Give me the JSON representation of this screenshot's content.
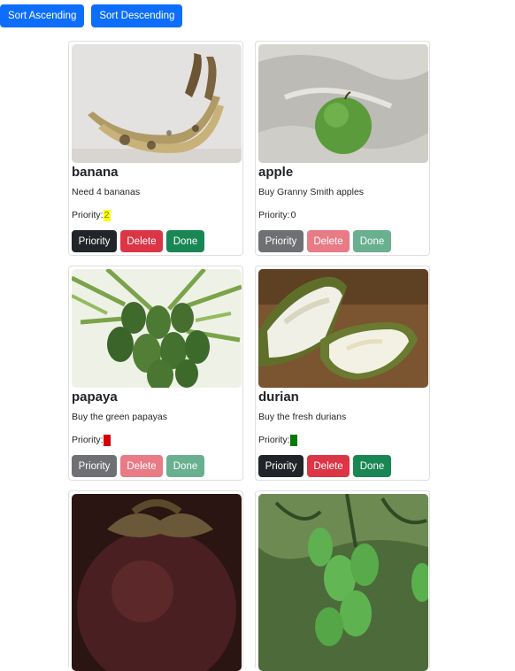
{
  "toolbar": {
    "sort_asc": "Sort Ascending",
    "sort_desc": "Sort Descending"
  },
  "priority_prefix": "Priority: ",
  "buttons": {
    "priority": "Priority",
    "delete": "Delete",
    "done": "Done"
  },
  "colors": {
    "primary": "#0d6efd",
    "dark": "#212529",
    "danger": "#dc3545",
    "success": "#198754",
    "yellow": "#ffff00",
    "red": "#d40000",
    "green": "#007a00"
  },
  "cards": [
    {
      "name": "banana",
      "description": "Need 4 bananas",
      "priority": "2",
      "priority_color": "yellow",
      "image": "banana",
      "buttons_disabled": false
    },
    {
      "name": "apple",
      "description": "Buy Granny Smith apples",
      "priority": "0",
      "priority_color": "none",
      "image": "green apple on cloth",
      "buttons_disabled": true
    },
    {
      "name": "papaya",
      "description": "Buy the green papayas",
      "priority": "",
      "priority_color": "red",
      "image": "green papayas on tree",
      "buttons_disabled": true
    },
    {
      "name": "durian",
      "description": "Buy the fresh durians",
      "priority": "",
      "priority_color": "green",
      "image": "opened durian",
      "buttons_disabled": false
    },
    {
      "image": "mangosteen"
    },
    {
      "image": "green mangoes on tree"
    }
  ]
}
